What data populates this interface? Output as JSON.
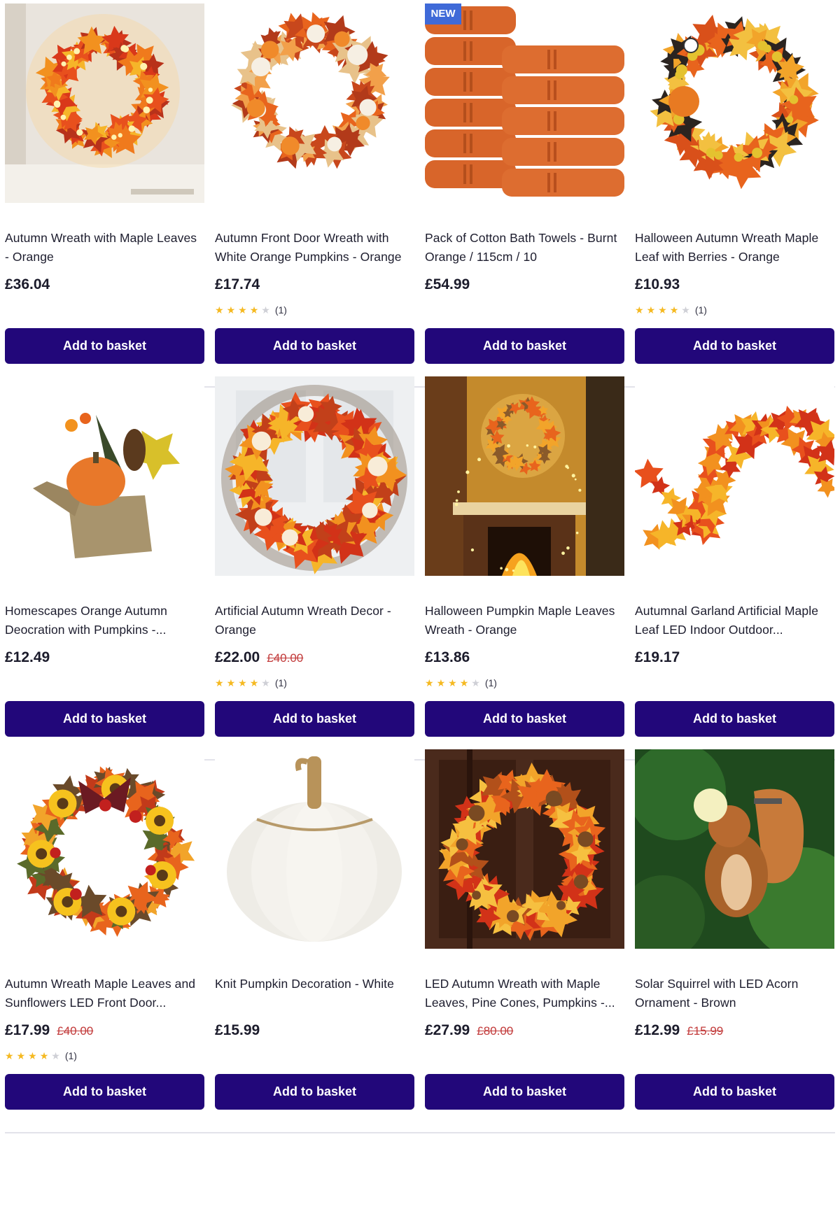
{
  "basket_label": "Add to basket",
  "new_badge": "NEW",
  "accent_colors": {
    "button": "#22077a",
    "badge": "#3f6ad8",
    "was_price": "#c23a3a",
    "star": "#f5b921"
  },
  "products": [
    {
      "title": "Autumn Wreath with Maple Leaves - Orange",
      "price": "£36.04",
      "was_price": "",
      "rating": null,
      "rating_count": "",
      "image": "lit-maple-wreath-on-shelf",
      "badge": false
    },
    {
      "title": "Autumn Front Door Wreath with White Orange Pumpkins - Orange",
      "price": "£17.74",
      "was_price": "",
      "rating": 4,
      "rating_count": "(1)",
      "image": "pumpkin-maple-wreath",
      "badge": false
    },
    {
      "title": "Pack of Cotton Bath Towels - Burnt Orange / 115cm / 10",
      "price": "£54.99",
      "was_price": "",
      "rating": null,
      "rating_count": "",
      "image": "stacked-orange-towels",
      "badge": true
    },
    {
      "title": "Halloween Autumn Wreath Maple Leaf with Berries - Orange",
      "price": "£10.93",
      "was_price": "",
      "rating": 4,
      "rating_count": "(1)",
      "image": "halloween-berry-wreath",
      "badge": false
    },
    {
      "title": "Homescapes Orange Autumn Deocration with Pumpkins -...",
      "price": "£12.49",
      "was_price": "",
      "rating": null,
      "rating_count": "",
      "image": "pumpkin-burlap-arrangement",
      "badge": false
    },
    {
      "title": "Artificial Autumn Wreath Decor - Orange",
      "price": "£22.00",
      "was_price": "£40.00",
      "rating": 4,
      "rating_count": "(1)",
      "image": "maple-twig-wreath-on-door",
      "badge": false
    },
    {
      "title": "Halloween Pumpkin Maple Leaves Wreath - Orange",
      "price": "£13.86",
      "was_price": "",
      "rating": 4,
      "rating_count": "(1)",
      "image": "wreath-over-fireplace",
      "badge": false
    },
    {
      "title": "Autumnal Garland Artificial Maple Leaf LED Indoor Outdoor...",
      "price": "£19.17",
      "was_price": "",
      "rating": null,
      "rating_count": "",
      "image": "maple-leaf-garland",
      "badge": false
    },
    {
      "title": "Autumn Wreath Maple Leaves and Sunflowers LED Front Door...",
      "price": "£17.99",
      "was_price": "£40.00",
      "rating": 4,
      "rating_count": "(1)",
      "image": "sunflower-plaid-bow-wreath",
      "badge": false
    },
    {
      "title": "Knit Pumpkin Decoration - White",
      "price": "£15.99",
      "was_price": "",
      "rating": null,
      "rating_count": "",
      "image": "white-knit-pumpkin",
      "badge": false
    },
    {
      "title": "LED Autumn Wreath with Maple Leaves, Pine Cones, Pumpkins -...",
      "price": "£27.99",
      "was_price": "£80.00",
      "rating": null,
      "rating_count": "",
      "image": "maple-wreath-on-wooden-door",
      "badge": false
    },
    {
      "title": "Solar Squirrel with LED Acorn Ornament - Brown",
      "price": "£12.99",
      "was_price": "£15.99",
      "rating": null,
      "rating_count": "",
      "image": "solar-squirrel-ornament",
      "badge": false
    }
  ]
}
